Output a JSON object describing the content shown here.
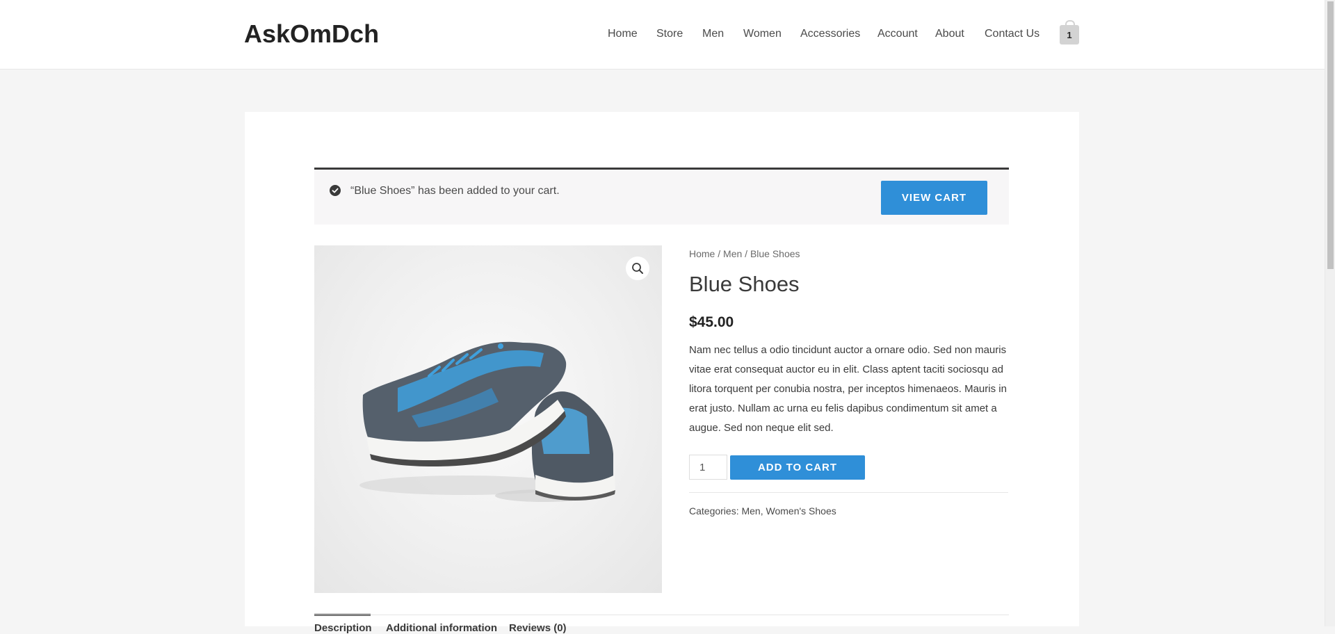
{
  "header": {
    "site_title": "AskOmDch",
    "nav": [
      {
        "label": "Home"
      },
      {
        "label": "Store"
      },
      {
        "label": "Men"
      },
      {
        "label": "Women"
      },
      {
        "label": "Accessories"
      },
      {
        "label": "Account"
      },
      {
        "label": "About"
      },
      {
        "label": "Contact Us"
      }
    ],
    "cart_count": "1"
  },
  "notice": {
    "message": "“Blue Shoes” has been added to your cart.",
    "view_cart_label": "VIEW CART",
    "icon": "check-circle-icon"
  },
  "breadcrumb": {
    "home": "Home",
    "separator": "/",
    "men": "Men",
    "current": "Blue Shoes"
  },
  "product": {
    "title": "Blue Shoes",
    "price": "$45.00",
    "description": "Nam nec tellus a odio tincidunt auctor a ornare odio. Sed non mauris vitae erat consequat auctor eu in elit. Class aptent taciti sociosqu ad litora torquent per conubia nostra, per inceptos himenaeos. Mauris in erat justo. Nullam ac urna eu felis dapibus condimentum sit amet a augue. Sed non neque elit sed.",
    "quantity": "1",
    "add_to_cart_label": "ADD TO CART",
    "categories_label": "Categories:",
    "categories": [
      "Men",
      "Women's Shoes"
    ],
    "image_icon": "zoom-icon"
  },
  "tabs": [
    {
      "label": "Description"
    },
    {
      "label": "Additional information"
    },
    {
      "label": "Reviews (0)"
    }
  ],
  "colors": {
    "accent": "#2f8fd8",
    "dark": "#3a3a3a",
    "background": "#f5f5f5"
  }
}
